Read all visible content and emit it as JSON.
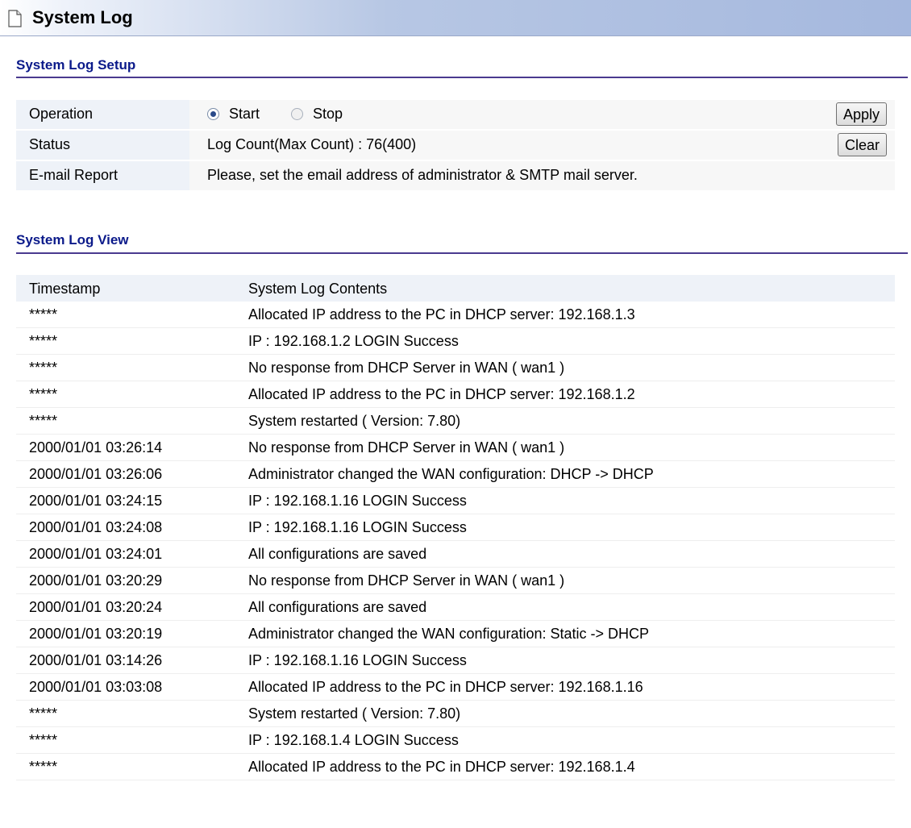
{
  "page": {
    "title": "System Log",
    "icon": "page-icon"
  },
  "setup": {
    "section_title": "System Log Setup",
    "operation": {
      "label": "Operation",
      "start_label": "Start",
      "stop_label": "Stop",
      "selected": "Start",
      "apply_label": "Apply"
    },
    "status": {
      "label": "Status",
      "value": "Log Count(Max Count) : 76(400)",
      "clear_label": "Clear"
    },
    "email": {
      "label": "E-mail Report",
      "value": "Please, set the email address of administrator & SMTP mail server."
    }
  },
  "log": {
    "section_title": "System Log View",
    "columns": [
      "Timestamp",
      "System Log Contents"
    ],
    "rows": [
      {
        "time": "*****",
        "content": "Allocated IP address to the PC in DHCP server: 192.168.1.3"
      },
      {
        "time": "*****",
        "content": "IP : 192.168.1.2 LOGIN Success"
      },
      {
        "time": "*****",
        "content": "No response from DHCP Server in WAN ( wan1 )"
      },
      {
        "time": "*****",
        "content": "Allocated IP address to the PC in DHCP server: 192.168.1.2"
      },
      {
        "time": "*****",
        "content": "System restarted ( Version: 7.80)"
      },
      {
        "time": "2000/01/01 03:26:14",
        "content": "No response from DHCP Server in WAN ( wan1 )"
      },
      {
        "time": "2000/01/01 03:26:06",
        "content": "Administrator changed the WAN configuration: DHCP -> DHCP"
      },
      {
        "time": "2000/01/01 03:24:15",
        "content": "IP : 192.168.1.16 LOGIN Success"
      },
      {
        "time": "2000/01/01 03:24:08",
        "content": "IP : 192.168.1.16 LOGIN Success"
      },
      {
        "time": "2000/01/01 03:24:01",
        "content": "All configurations are saved"
      },
      {
        "time": "2000/01/01 03:20:29",
        "content": "No response from DHCP Server in WAN ( wan1 )"
      },
      {
        "time": "2000/01/01 03:20:24",
        "content": "All configurations are saved"
      },
      {
        "time": "2000/01/01 03:20:19",
        "content": "Administrator changed the WAN configuration: Static -> DHCP"
      },
      {
        "time": "2000/01/01 03:14:26",
        "content": "IP : 192.168.1.16 LOGIN Success"
      },
      {
        "time": "2000/01/01 03:03:08",
        "content": "Allocated IP address to the PC in DHCP server: 192.168.1.16"
      },
      {
        "time": "*****",
        "content": "System restarted ( Version: 7.80)"
      },
      {
        "time": "*****",
        "content": "IP : 192.168.1.4 LOGIN Success"
      },
      {
        "time": "*****",
        "content": "Allocated IP address to the PC in DHCP server: 192.168.1.4"
      }
    ]
  }
}
